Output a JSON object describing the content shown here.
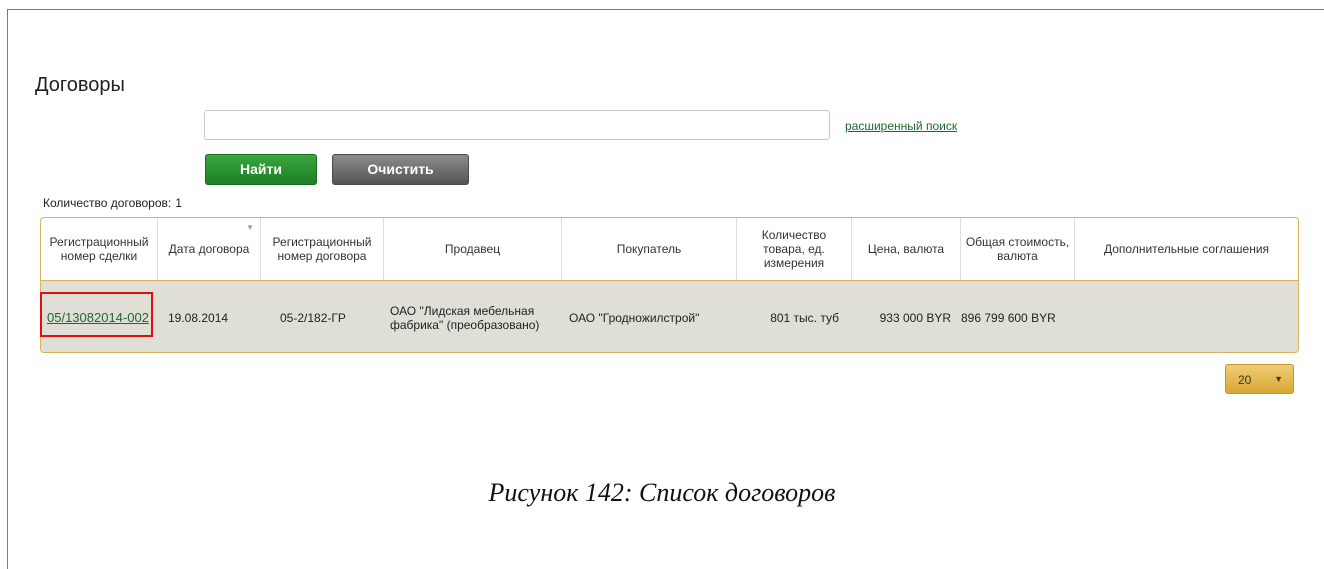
{
  "page": {
    "title": "Договоры"
  },
  "search": {
    "value": "",
    "placeholder": "",
    "advanced_link": "расширенный поиск"
  },
  "buttons": {
    "find": "Найти",
    "clear": "Очистить"
  },
  "count": {
    "label": "Количество договоров:",
    "value": "1"
  },
  "table": {
    "columns": [
      "Регистрационный номер сделки",
      "Дата договора",
      "Регистрационный номер договора",
      "Продавец",
      "Покупатель",
      "Количество товара, ед. измерения",
      "Цена, валюта",
      "Общая стоимость, валюта",
      "Дополнительные соглашения"
    ],
    "rows": [
      {
        "deal_number": "05/13082014-002",
        "contract_date": "19.08.2014",
        "contract_number": "05-2/182-ГР",
        "seller": "ОАО \"Лидская мебельная фабрика\" (преобразовано)",
        "buyer": "ОАО \"Гродножилстрой\"",
        "quantity": "801 тыс. туб",
        "price": "933 000 BYR",
        "total": "896 799 600 BYR",
        "agreements": ""
      }
    ]
  },
  "pagination": {
    "page_size": "20"
  },
  "caption": "Рисунок 142: Список договоров",
  "colors": {
    "accent_green": "#1c7f25",
    "link_green": "#1c6a2d",
    "border_gold": "#d9b25c",
    "highlight_red": "#e01010"
  },
  "icons": {
    "sort": "sort-down-icon",
    "dropdown": "caret-down-icon"
  }
}
